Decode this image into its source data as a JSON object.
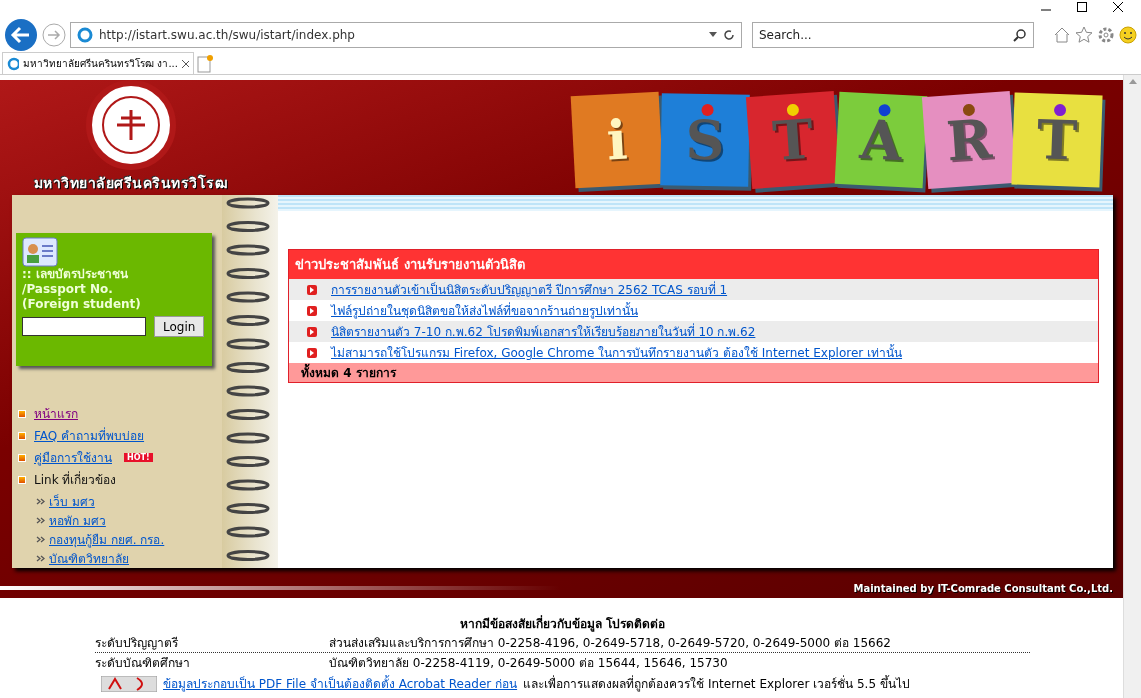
{
  "browser": {
    "address": "http://istart.swu.ac.th/swu/istart/index.php",
    "search_placeholder": "Search...",
    "tabs": [
      {
        "title": "มหาวิทยาลัยศรีนครินทรวิโรฒ งา...",
        "selected": true
      }
    ]
  },
  "header": {
    "university_name": "มหาวิทยาลัยศรีนครินทรวิโรฒ",
    "logo_letters": [
      {
        "letter": "i",
        "color": "#e07a22"
      },
      {
        "letter": "S",
        "color": "#1e7fd8"
      },
      {
        "letter": "T",
        "color": "#d8262e"
      },
      {
        "letter": "A",
        "color": "#7ccc3c"
      },
      {
        "letter": "R",
        "color": "#e58fc0"
      },
      {
        "letter": "T",
        "color": "#e8e040"
      }
    ]
  },
  "login": {
    "label_lines": [
      ":: เลขบัตรประชาชน",
      "/Passport No.",
      "(Foreign student)"
    ],
    "button": "Login"
  },
  "menu": [
    {
      "label": "หน้าแรก",
      "kind": "link",
      "visited": true
    },
    {
      "label": "FAQ คำถามที่พบบ่อย",
      "kind": "link",
      "visited": false
    },
    {
      "label": "คู่มือการใช้งาน",
      "kind": "link",
      "visited": false,
      "badge": "HOT!"
    },
    {
      "label": "Link ที่เกี่ยวข้อง",
      "kind": "heading",
      "children": [
        {
          "label": "เว็บ มศว"
        },
        {
          "label": "หอพัก มศว"
        },
        {
          "label": "กองทุนกู้ยืม กยศ. กรอ."
        },
        {
          "label": "บัณฑิตวิทยาลัย"
        }
      ]
    }
  ],
  "news": {
    "title": "ข่าวประชาสัมพันธ์ งานรับรายงานตัวนิสิต",
    "items": [
      "การรายงานตัวเข้าเป็นนิสิตระดับปริญญาตรี ปีการศึกษา 2562 TCAS รอบที่ 1",
      "ไฟล์รูปถ่ายในชุดนิสิตขอให้ส่งไฟล์ที่ขอจากร้านถ่ายรูปเท่านั้น",
      "นิสิตรายงานตัว 7-10 ก.พ.62 โปรดพิมพ์เอกสารให้เรียบร้อยภายในวันที่ 10 ก.พ.62",
      "ไม่สามารถใช้โปรแกรม Firefox, Google Chrome ในการบันทึกรายงานตัว ต้องใช้ Internet Explorer เท่านั้น"
    ],
    "total": "ทั้งหมด 4 รายการ"
  },
  "maintained_by": "Maintained by IT-Comrade Consultant Co.,Ltd.",
  "contact": {
    "heading": "หากมีข้อสงสัยเกี่ยวกับข้อมูล โปรดติดต่อ",
    "rows": [
      {
        "label": "ระดับปริญญาตรี",
        "value": "ส่วนส่งเสริมและบริการการศึกษา 0-2258-4196, 0-2649-5718, 0-2649-5720, 0-2649-5000 ต่อ 15662"
      },
      {
        "label": "ระดับบัณฑิตศึกษา",
        "value": "บัณฑิตวิทยาลัย 0-2258-4119, 0-2649-5000 ต่อ 15644, 15646, 15730"
      }
    ],
    "pdf_link": "ข้อมูลประกอบเป็น PDF File จำเป็นต้องติดตั้ง Acrobat Reader ก่อน",
    "pdf_note": "และเพื่อการแสดงผลที่ถูกต้องควรใช้ Internet Explorer เวอร์ชั่น 5.5 ขึ้นไป"
  }
}
